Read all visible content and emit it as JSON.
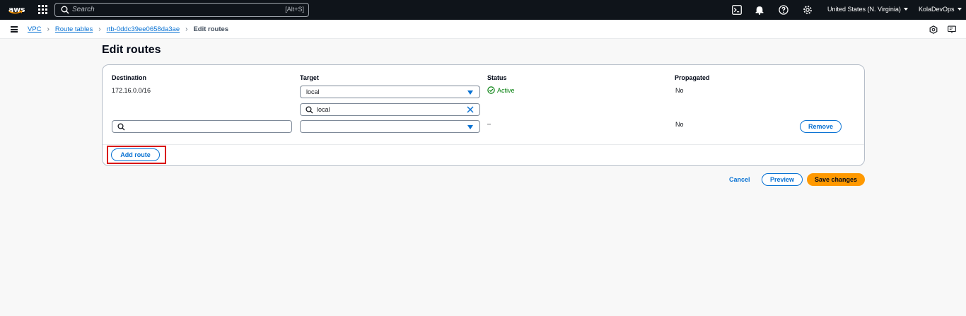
{
  "topnav": {
    "logo_text": "aws",
    "search_placeholder": "Search",
    "search_shortcut": "[Alt+S]",
    "region": "United States (N. Virginia)",
    "account": "KolaDevOps"
  },
  "breadcrumbs": {
    "items": [
      "VPC",
      "Route tables",
      "rtb-0ddc39ee0658da3ae"
    ],
    "current": "Edit routes"
  },
  "page": {
    "title": "Edit routes"
  },
  "table": {
    "headers": {
      "destination": "Destination",
      "target": "Target",
      "status": "Status",
      "propagated": "Propagated"
    },
    "row1": {
      "destination": "172.16.0.0/16",
      "target_value": "local",
      "target_filter": "local",
      "status": "Active",
      "propagated": "No"
    },
    "row2": {
      "destination": "",
      "target_value": "",
      "status": "–",
      "propagated": "No",
      "remove_label": "Remove"
    },
    "add_route_label": "Add route"
  },
  "actions": {
    "cancel": "Cancel",
    "preview": "Preview",
    "save": "Save changes"
  },
  "colors": {
    "brand_orange": "#ff9900",
    "link_blue": "#0972d3",
    "success_green": "#037f0c",
    "nav_bg": "#0f141a",
    "highlight_red": "#d91515"
  }
}
